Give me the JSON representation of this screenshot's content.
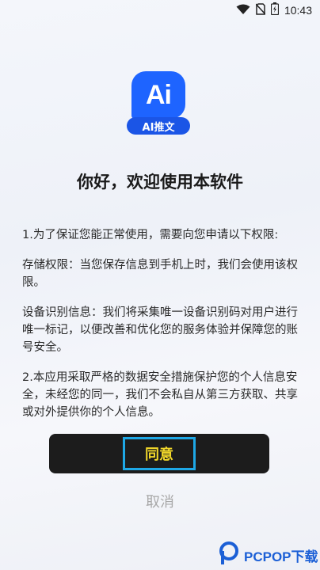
{
  "status_bar": {
    "time": "10:43"
  },
  "logo": {
    "mark": "Ai",
    "label": "AI推文"
  },
  "dialog": {
    "title": "你好，欢迎使用本软件",
    "paragraphs": [
      "1.为了保证您能正常使用，需要向您申请以下权限:",
      "存储权限：当您保存信息到手机上时，我们会使用该权限。",
      "设备识别信息：我们将采集唯一设备识别码对用户进行唯一标记，以便改善和优化您的服务体验并保障您的账号安全。",
      "2.本应用采取严格的数据安全措施保护您的个人信息安全，未经您的同一，我们不会私自从第三方获取、共享或对外提供你的个人信息。"
    ],
    "agree_label": "同意",
    "cancel_label": "取消"
  },
  "watermark": {
    "text": "PCPOP下载"
  },
  "icons": [
    "wifi-icon",
    "sim-off-icon",
    "battery-charging-icon",
    "pcpop-logo-icon"
  ]
}
